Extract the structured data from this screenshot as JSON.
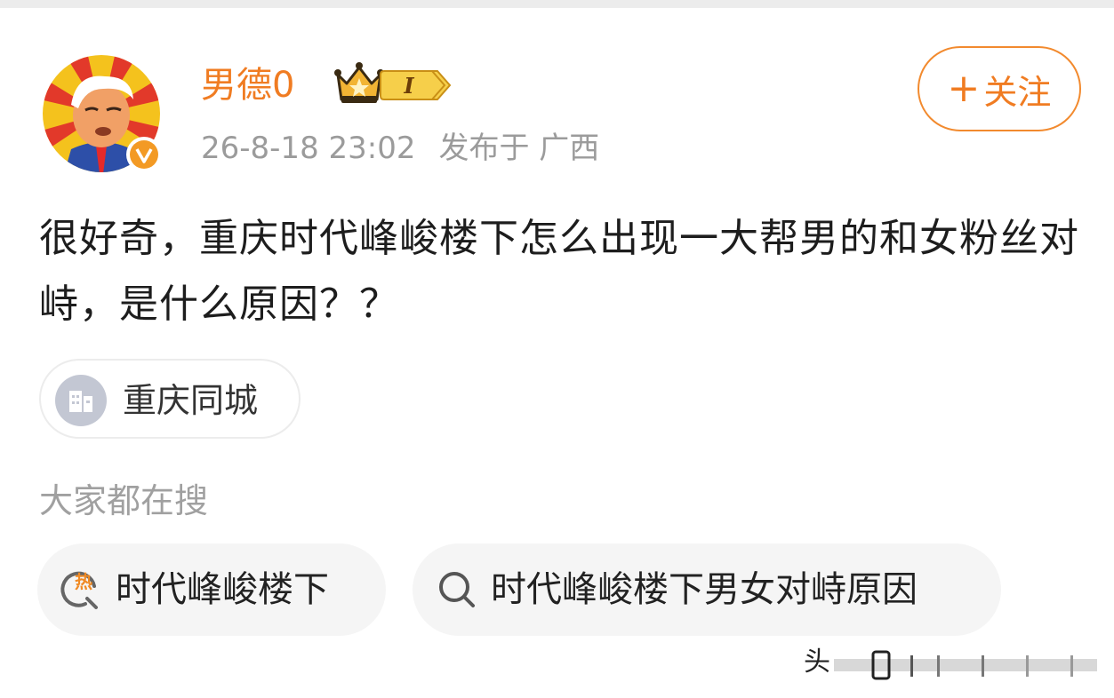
{
  "user": {
    "name": "男德0",
    "level_label": "I",
    "timestamp": "26-8-18 23:02",
    "location": "发布于 广西"
  },
  "follow": {
    "plus": "+",
    "label": "关注"
  },
  "post": {
    "text": "很好奇，重庆时代峰峻楼下怎么出现一大帮男的和女粉丝对峙，是什么原因？？"
  },
  "topic_tag": {
    "label": "重庆同城",
    "icon": "building-icon"
  },
  "everyone_searching": {
    "heading": "大家都在搜",
    "items": [
      {
        "label": "时代峰峻楼下",
        "icon": "hot-search-icon",
        "icon_text": "热"
      },
      {
        "label": "时代峰峻楼下男女对峙原因",
        "icon": "search-icon"
      }
    ]
  },
  "watermark": {
    "char": "头"
  },
  "colors": {
    "accent": "#f07c22",
    "meta_gray": "#9b9b9b",
    "pill_bg": "#f5f5f5"
  }
}
